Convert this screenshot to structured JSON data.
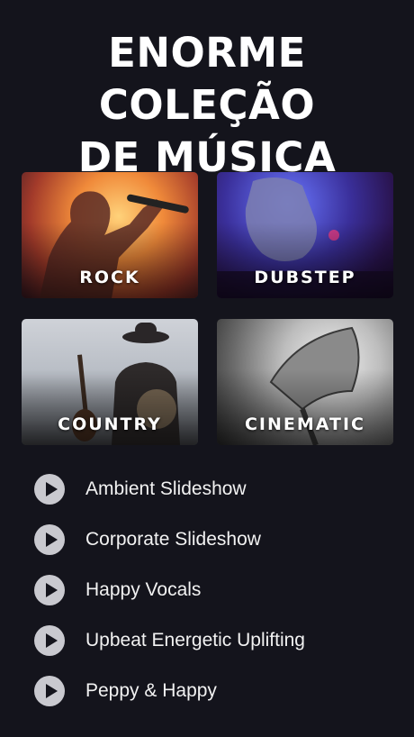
{
  "headline": {
    "line1": "ENORME COLEÇÃO",
    "line2": "DE MÚSICA"
  },
  "genres": [
    {
      "label": "ROCK"
    },
    {
      "label": "DUBSTEP"
    },
    {
      "label": "COUNTRY"
    },
    {
      "label": "CINEMATIC"
    }
  ],
  "tracks": [
    {
      "title": "Ambient Slideshow",
      "icon": "play-icon"
    },
    {
      "title": "Corporate Slideshow",
      "icon": "play-icon"
    },
    {
      "title": "Happy Vocals",
      "icon": "play-icon"
    },
    {
      "title": "Upbeat Energetic Uplifting",
      "icon": "play-icon"
    },
    {
      "title": "Peppy & Happy",
      "icon": "play-icon"
    }
  ],
  "colors": {
    "background": "#14141c",
    "play_button": "#c9c9cf"
  }
}
